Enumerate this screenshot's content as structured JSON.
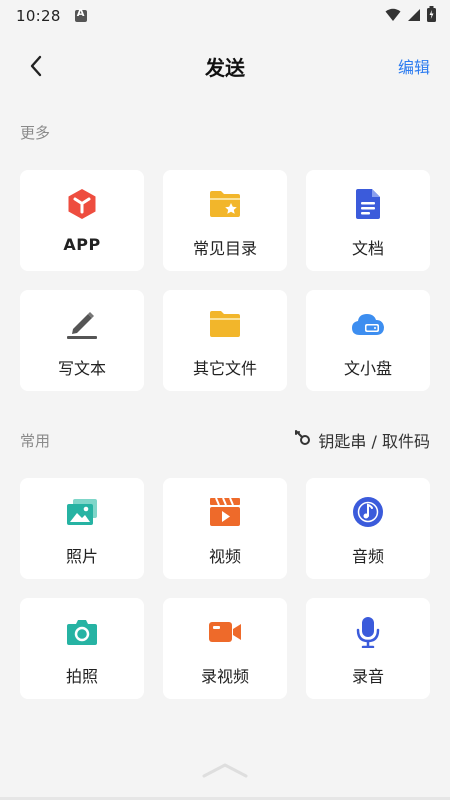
{
  "status_bar": {
    "time": "10:28"
  },
  "header": {
    "title": "发送",
    "edit_label": "编辑"
  },
  "sections": {
    "more": {
      "label": "更多",
      "items": [
        {
          "label": "APP",
          "icon": "app-cube-icon"
        },
        {
          "label": "常见目录",
          "icon": "starred-folder-icon"
        },
        {
          "label": "文档",
          "icon": "document-icon"
        },
        {
          "label": "写文本",
          "icon": "pencil-icon"
        },
        {
          "label": "其它文件",
          "icon": "folder-icon"
        },
        {
          "label": "文小盘",
          "icon": "cloud-drive-icon"
        }
      ]
    },
    "common": {
      "label": "常用",
      "key_link": "钥匙串 / 取件码",
      "items": [
        {
          "label": "照片",
          "icon": "photos-icon"
        },
        {
          "label": "视频",
          "icon": "video-icon"
        },
        {
          "label": "音频",
          "icon": "music-icon"
        },
        {
          "label": "拍照",
          "icon": "camera-icon"
        },
        {
          "label": "录视频",
          "icon": "video-camera-icon"
        },
        {
          "label": "录音",
          "icon": "microphone-icon"
        }
      ]
    }
  },
  "colors": {
    "accent": "#2d7cf0",
    "app_red": "#ee4d3f",
    "folder_yellow": "#f2b62b",
    "doc_blue": "#3b5bdb",
    "cloud_blue": "#3d8ef0",
    "teal": "#26b3a3",
    "orange": "#ee6a2a"
  }
}
